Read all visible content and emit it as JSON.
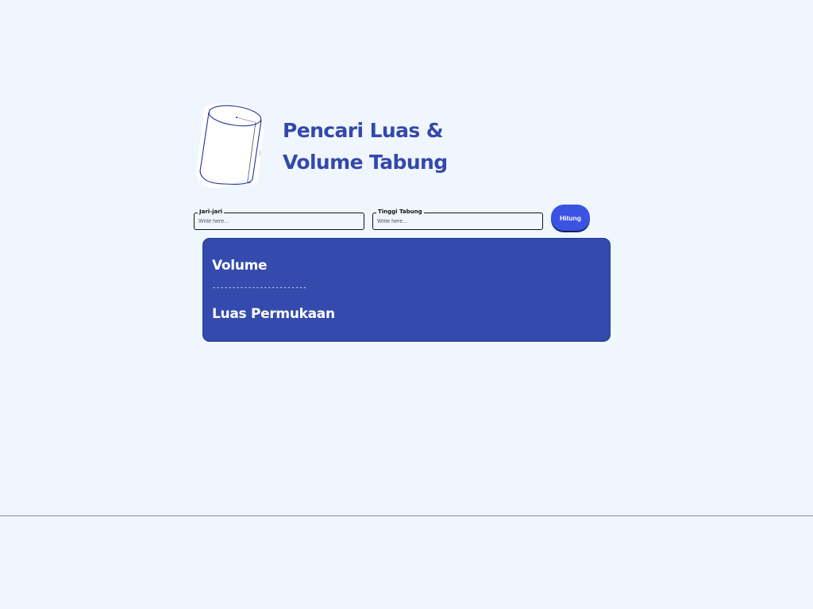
{
  "header": {
    "illustration_icon": "cylinder-sketch-icon",
    "title_line1": "Pencari Luas &",
    "title_line2": "Volume Tabung"
  },
  "form": {
    "radius": {
      "label": "Jari-jari",
      "placeholder": "Write here...",
      "value": ""
    },
    "height": {
      "label": "Tinggi Tabung",
      "placeholder": "Write here...",
      "value": ""
    },
    "submit_label": "Hitung"
  },
  "result": {
    "volume_label": "Volume",
    "divider": "------------------------",
    "area_label": "Luas Permukaan"
  },
  "colors": {
    "background": "#f0f6fe",
    "accent": "#3448ac",
    "button": "#3b53e3",
    "card": "#344bad",
    "text_on_card": "#ffffff"
  }
}
